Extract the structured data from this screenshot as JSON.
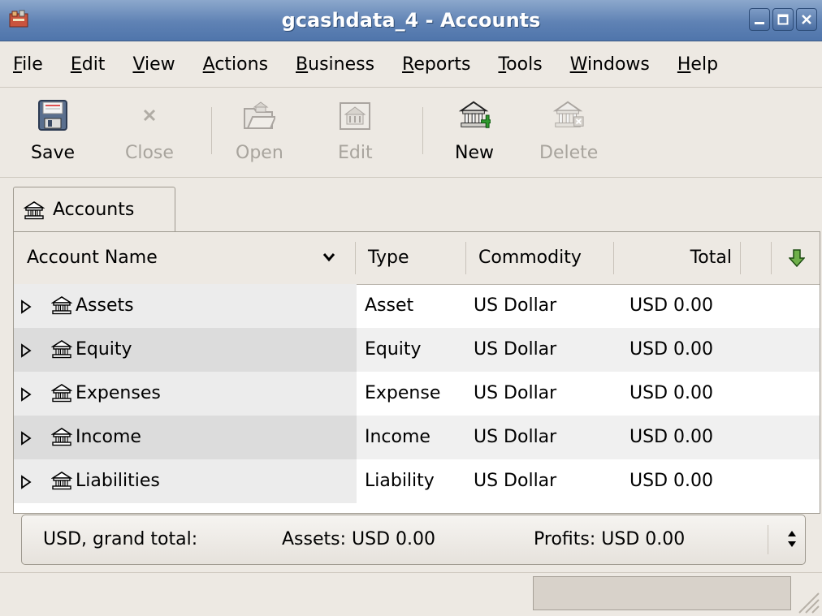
{
  "window": {
    "title": "gcashdata_4 - Accounts"
  },
  "menubar": [
    {
      "label": "File",
      "mnemonic": "F"
    },
    {
      "label": "Edit",
      "mnemonic": "E"
    },
    {
      "label": "View",
      "mnemonic": "V"
    },
    {
      "label": "Actions",
      "mnemonic": "A"
    },
    {
      "label": "Business",
      "mnemonic": "B"
    },
    {
      "label": "Reports",
      "mnemonic": "R"
    },
    {
      "label": "Tools",
      "mnemonic": "T"
    },
    {
      "label": "Windows",
      "mnemonic": "W"
    },
    {
      "label": "Help",
      "mnemonic": "H"
    }
  ],
  "toolbar": {
    "save_label": "Save",
    "close_label": "Close",
    "open_label": "Open",
    "edit_label": "Edit",
    "new_label": "New",
    "delete_label": "Delete"
  },
  "tab": {
    "label": "Accounts"
  },
  "columns": {
    "name": "Account Name",
    "type": "Type",
    "commodity": "Commodity",
    "total": "Total"
  },
  "accounts": [
    {
      "name": "Assets",
      "type": "Asset",
      "commodity": "US Dollar",
      "total": "USD 0.00"
    },
    {
      "name": "Equity",
      "type": "Equity",
      "commodity": "US Dollar",
      "total": "USD 0.00"
    },
    {
      "name": "Expenses",
      "type": "Expense",
      "commodity": "US Dollar",
      "total": "USD 0.00"
    },
    {
      "name": "Income",
      "type": "Income",
      "commodity": "US Dollar",
      "total": "USD 0.00"
    },
    {
      "name": "Liabilities",
      "type": "Liability",
      "commodity": "US Dollar",
      "total": "USD 0.00"
    }
  ],
  "summary": {
    "label": "USD, grand total:",
    "assets": "Assets: USD 0.00",
    "profits": "Profits: USD 0.00"
  },
  "icons": {
    "app": "gnucash-app-icon",
    "save": "floppy-disk-icon",
    "close": "close-x-icon",
    "open": "open-account-icon",
    "edit": "edit-account-icon",
    "new": "new-account-icon",
    "delete": "delete-account-icon",
    "account": "bank-account-icon"
  },
  "colors": {
    "titlebar": "#5f82b4",
    "disabled_text": "#a8a49d"
  }
}
